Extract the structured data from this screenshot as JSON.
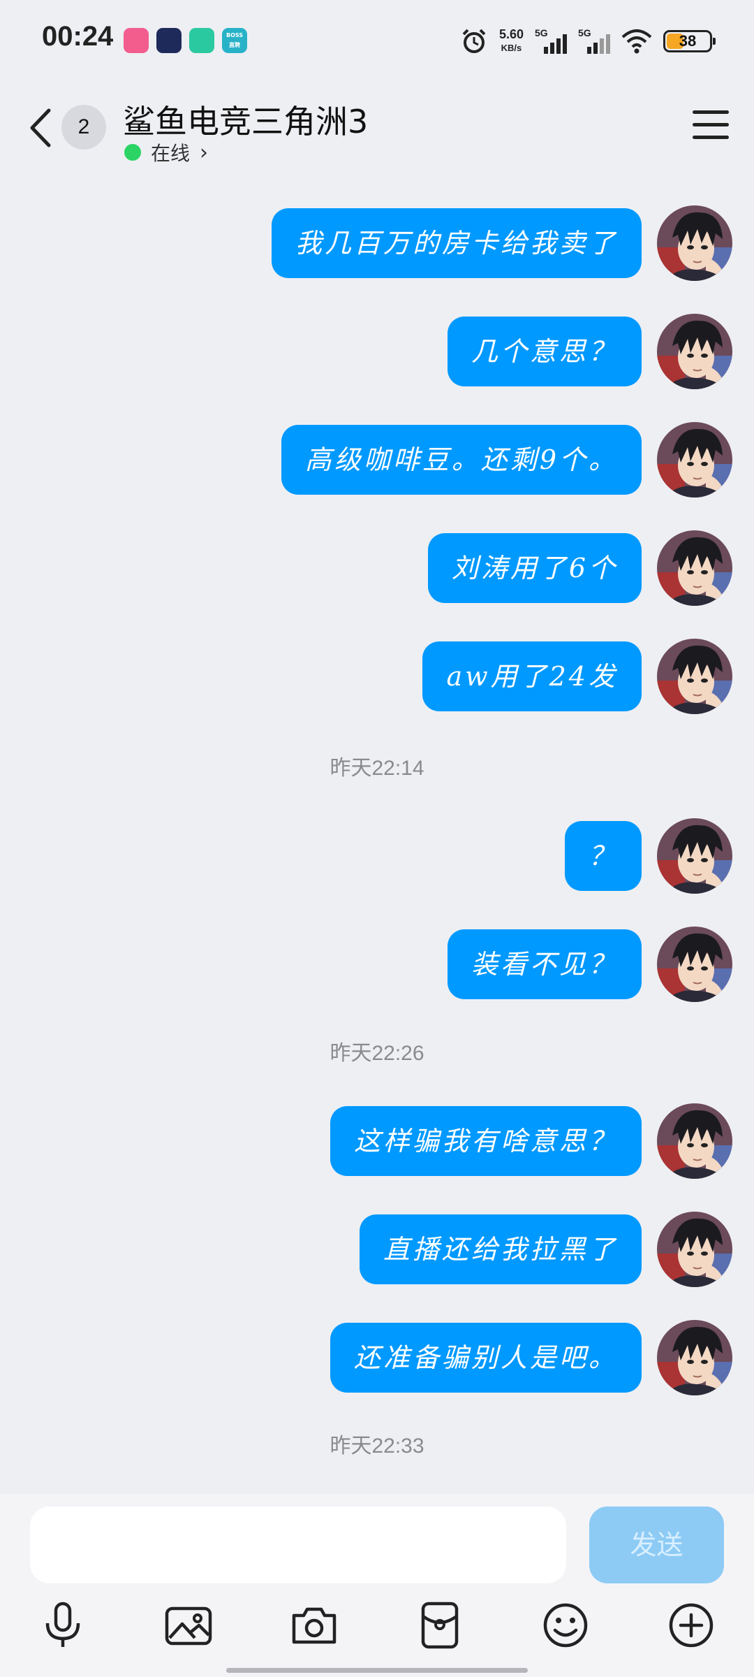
{
  "status_bar": {
    "time": "00:24",
    "net_speed": "5.60",
    "net_speed_unit": "KB/s",
    "sim1": "5G",
    "sim2": "5G",
    "battery": "38",
    "app_icons": [
      "bilibili-icon",
      "app-face-icon",
      "shield-app-icon",
      "boss-zhipin-icon"
    ],
    "boss_label": "BOSS\n直聘"
  },
  "header": {
    "unread_count": "2",
    "title": "鲨鱼电竞三角洲3",
    "status": "在线",
    "online_color": "#2bd464"
  },
  "messages": [
    {
      "type": "out",
      "text": "我几百万的房卡给我卖了"
    },
    {
      "type": "out",
      "text": "几个意思？"
    },
    {
      "type": "out",
      "text": "高级咖啡豆。还剩9个。"
    },
    {
      "type": "out",
      "text": "刘涛用了6个"
    },
    {
      "type": "out",
      "text": "aw用了24发"
    },
    {
      "type": "time",
      "text": "昨天22:14"
    },
    {
      "type": "out",
      "text": "？"
    },
    {
      "type": "out",
      "text": "装看不见？"
    },
    {
      "type": "time",
      "text": "昨天22:26"
    },
    {
      "type": "out",
      "text": "这样骗我有啥意思？"
    },
    {
      "type": "out",
      "text": "直播还给我拉黑了"
    },
    {
      "type": "out",
      "text": "还准备骗别人是吧。"
    },
    {
      "type": "time",
      "text": "昨天22:33"
    }
  ],
  "input": {
    "value": "",
    "send_label": "发送"
  },
  "toolbar": [
    "microphone-icon",
    "image-icon",
    "camera-icon",
    "red-packet-icon",
    "emoji-icon",
    "plus-icon"
  ],
  "colors": {
    "bubble": "#0099ff",
    "background": "#eeeff3",
    "send_disabled": "#8dcbf5"
  }
}
